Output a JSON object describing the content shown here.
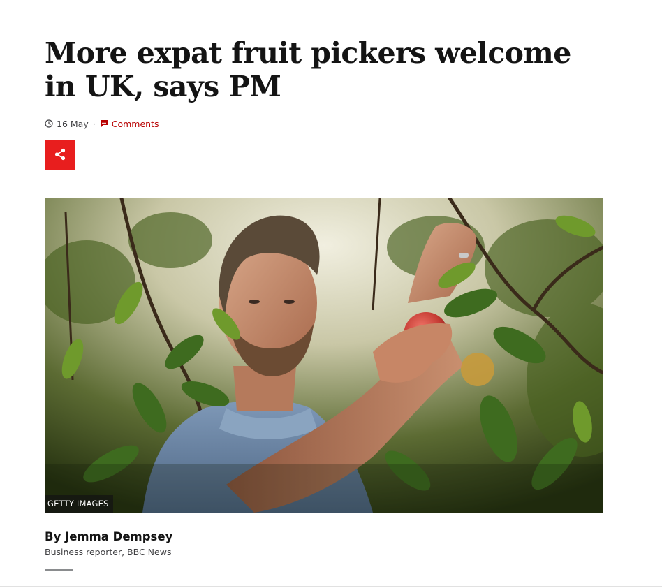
{
  "article": {
    "headline": "More expat fruit pickers welcome in UK, says PM",
    "date": "16 May",
    "separator": "·",
    "comments_label": "Comments",
    "share_icon": "share-icon",
    "clock_icon": "clock-icon",
    "comment_icon": "comment-icon"
  },
  "image": {
    "credit": "GETTY IMAGES",
    "subject": "man picking apples in an orchard"
  },
  "byline": {
    "author": "By Jemma Dempsey",
    "role": "Business reporter, BBC News"
  },
  "colors": {
    "accent_red": "#b80000",
    "share_button": "#e81e1e",
    "text": "#141414",
    "muted": "#3f3f42"
  }
}
